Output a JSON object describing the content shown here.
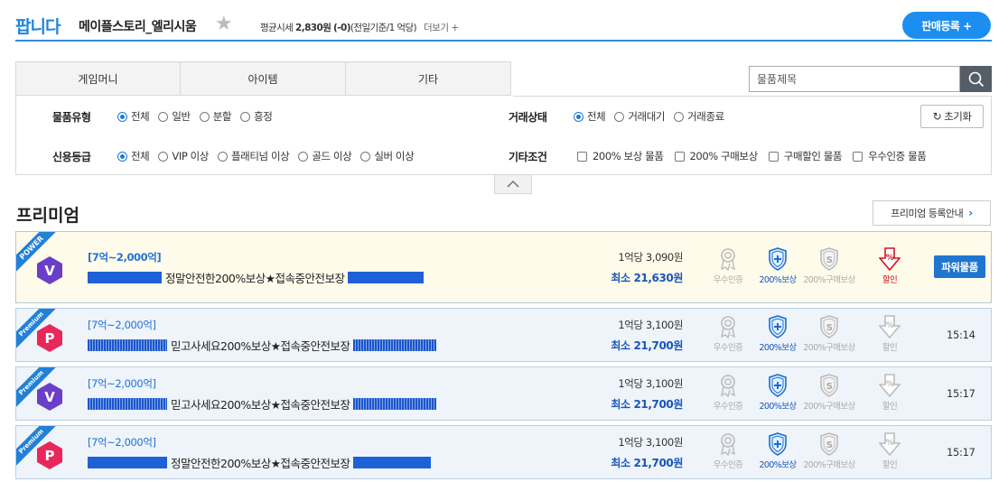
{
  "header": {
    "title": "팝니다",
    "game": "메이플스토리_엘리시움",
    "avg_label": "평균시세",
    "avg_value": "2,830원",
    "avg_change": "(-0)",
    "avg_basis": "(전일기준/1 억당)",
    "more": "더보기 +",
    "sell_button": "판매등록 +"
  },
  "tabs": [
    "게임머니",
    "아이템",
    "기타"
  ],
  "search": {
    "placeholder": "물품제목"
  },
  "filters": {
    "item_type": {
      "label": "물품유형",
      "options": [
        "전체",
        "일반",
        "분할",
        "흥정"
      ],
      "selected": 0
    },
    "trade_status": {
      "label": "거래상태",
      "options": [
        "전체",
        "거래대기",
        "거래종료"
      ],
      "selected": 0
    },
    "credit": {
      "label": "신용등급",
      "options": [
        "전체",
        "VIP 이상",
        "플래티넘 이상",
        "골드 이상",
        "실버 이상"
      ],
      "selected": 0
    },
    "etc": {
      "label": "기타조건",
      "options": [
        "200% 보상 물품",
        "200% 구매보상",
        "구매할인 물품",
        "우수인증 물품"
      ]
    },
    "reset": "초기화"
  },
  "premium": {
    "title": "프리미엄",
    "guide": "프리미엄 등록안내",
    "icon_labels": [
      "우수인증",
      "200%보상",
      "200%구매보상",
      "할인"
    ],
    "items": [
      {
        "ribbon": "POWER",
        "badge": "V",
        "badge_color": "#6a3fc8",
        "range": "[7억~2,000억]",
        "title": "정말안전한200%보상★접속중안전보장",
        "rate": "1억당 3,090원",
        "min": "최소 21,630원",
        "status": "파워물품",
        "discount_active": true
      },
      {
        "ribbon": "Premium",
        "badge": "P",
        "badge_color": "#e8285a",
        "range": "[7억~2,000억]",
        "title": "믿고사세요200%보상★접속중안전보장",
        "rate": "1억당 3,100원",
        "min": "최소 21,700원",
        "status": "15:14",
        "discount_active": false
      },
      {
        "ribbon": "Premium",
        "badge": "V",
        "badge_color": "#6a3fc8",
        "range": "[7억~2,000억]",
        "title": "믿고사세요200%보상★접속중안전보장",
        "rate": "1억당 3,100원",
        "min": "최소 21,700원",
        "status": "15:17",
        "discount_active": false
      },
      {
        "ribbon": "Premium",
        "badge": "P",
        "badge_color": "#e8285a",
        "range": "[7억~2,000억]",
        "title": "정말안전한200%보상★접속중안전보장",
        "rate": "1억당 3,100원",
        "min": "최소 21,700원",
        "status": "15:17",
        "discount_active": false
      }
    ]
  }
}
